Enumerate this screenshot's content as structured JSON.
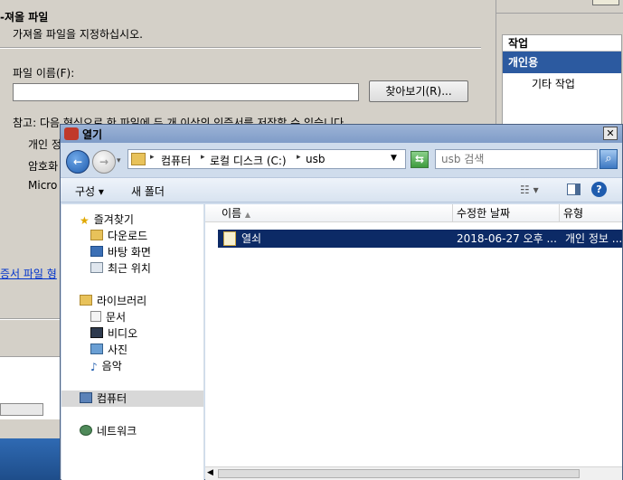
{
  "wizard": {
    "title": "-져올 파일",
    "subtitle": "가져올 파일을 지정하십시오.",
    "file_label": "파일 이름(F):",
    "file_value": "",
    "browse_label": "찾아보기(R)...",
    "note": "참고: 다음 형식으로 한 파일에 두 개 이상의 인증서를 저장할 수 있습니다.",
    "options": [
      "개인 정",
      "암호화",
      "Micro"
    ],
    "link": "증서 파일 형"
  },
  "actions": {
    "header": "작업",
    "selected": "개인용",
    "item": "기타 작업"
  },
  "dialog": {
    "title": "열기",
    "address": {
      "crumbs": [
        "컴퓨터",
        "로컬 디스크 (C:)",
        "usb"
      ],
      "separator": "▸"
    },
    "search_placeholder": "usb 검색",
    "commands": {
      "organize": "구성 ▾",
      "new_folder": "새 폴더"
    },
    "nav": {
      "favorites": "즐겨찾기",
      "downloads": "다운로드",
      "desktop": "바탕 화면",
      "recent": "최근 위치",
      "libraries": "라이브러리",
      "documents": "문서",
      "videos": "비디오",
      "pictures": "사진",
      "music": "음악",
      "computer": "컴퓨터",
      "network": "네트워크"
    },
    "columns": {
      "name": "이름",
      "modified": "수정한 날짜",
      "type": "유형"
    },
    "files": [
      {
        "name": "열쇠",
        "modified": "2018-06-27 오후 ...",
        "type": "개인 정보 ..."
      }
    ]
  }
}
